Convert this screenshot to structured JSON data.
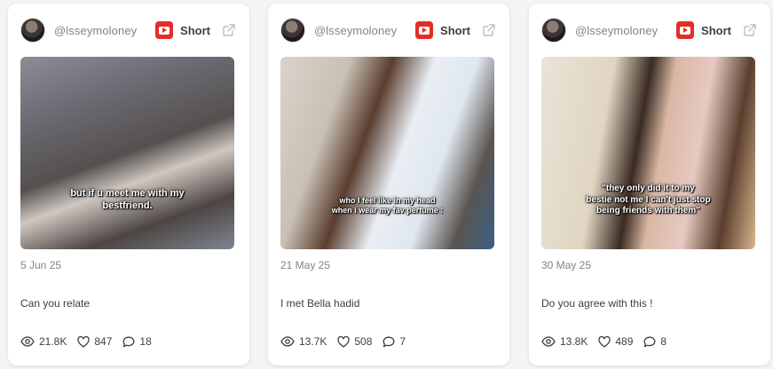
{
  "cards": [
    {
      "handle": "@lsseymoloney",
      "platform_icon": "youtube-icon",
      "type_label": "Short",
      "thumbnail_caption": "but if u meet me with my\nbestfriend.",
      "date": "5 Jun 25",
      "title": "Can you relate",
      "views": "21.8K",
      "likes": "847",
      "comments": "18"
    },
    {
      "handle": "@lsseymoloney",
      "platform_icon": "youtube-icon",
      "type_label": "Short",
      "thumbnail_caption": "who I feel like in my head\nwhen i wear my fav perfume :",
      "date": "21 May 25",
      "title": "I met Bella hadid",
      "views": "13.7K",
      "likes": "508",
      "comments": "7"
    },
    {
      "handle": "@lsseymoloney",
      "platform_icon": "youtube-icon",
      "type_label": "Short",
      "thumbnail_caption": "\"they only did it to my\nbestie not me I can't just stop\nbeing friends with them\"",
      "date": "30 May 25",
      "title": "Do you agree with this !",
      "views": "13.8K",
      "likes": "489",
      "comments": "8"
    }
  ],
  "colors": {
    "youtube_red": "#e52d27",
    "muted_text": "#7b8590",
    "body_text": "#3a3f45"
  }
}
